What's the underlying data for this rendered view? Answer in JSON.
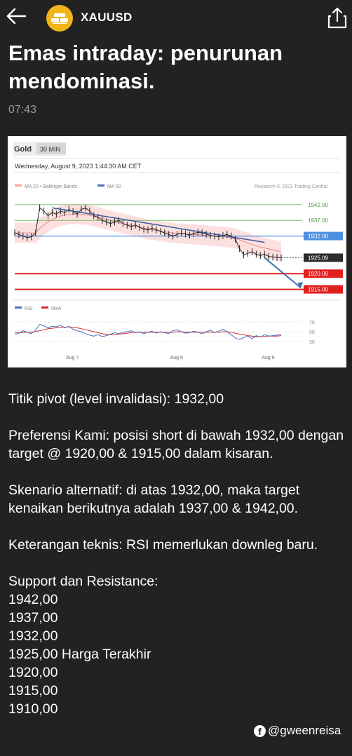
{
  "header": {
    "symbol": "XAUUSD",
    "back_icon": "arrow-left-icon",
    "share_icon": "share-icon",
    "logo_icon": "gold-bars-icon",
    "logo_color": "#f0b519"
  },
  "article": {
    "title": "Emas intraday: penurunan mendominasi.",
    "time": "07:43",
    "paragraphs": [
      "Titik pivot (level invalidasi): 1932,00",
      "Preferensi Kami: posisi short di bawah 1932,00 dengan target @ 1920,00 & 1915,00 dalam kisaran.",
      "Skenario alternatif: di atas 1932,00, maka target kenaikan berikutnya adalah 1937,00 & 1942,00.",
      "Keterangan teknis: RSI memerlukan downleg baru."
    ],
    "sr_title": "Support dan Resistance:",
    "sr_levels": [
      "1942,00",
      "1937,00",
      "1932,00",
      "1925,00 Harga Terakhir",
      "1920,00",
      "1915,00",
      "1910,00"
    ]
  },
  "watermark": {
    "icon": "facebook-icon",
    "text": "@gweenreisa"
  },
  "chart_data": {
    "type": "line",
    "instrument": "Gold",
    "timeframe": "30 MIN",
    "datetime": "Wednesday, August 9, 2023 1:44:30 AM CET",
    "legend": [
      "MA 20 • Bollinger Bands",
      "MA 50"
    ],
    "credit": "Research © 2023 Trading Central",
    "x_ticks": [
      "Aug 7",
      "Aug 8",
      "Aug 9"
    ],
    "ylim": [
      1912,
      1946
    ],
    "levels": [
      {
        "label": "1942.00",
        "value": 1942,
        "color": "#7cc46a",
        "style": "tag-green"
      },
      {
        "label": "1937.00",
        "value": 1937,
        "color": "#7cc46a",
        "style": "tag-green"
      },
      {
        "label": "1932.00",
        "value": 1932,
        "color": "#4d8fe0",
        "style": "box-blue"
      },
      {
        "label": "1925.09",
        "value": 1925.09,
        "color": "#2b2b2b",
        "style": "box-dark"
      },
      {
        "label": "1920.00",
        "value": 1920,
        "color": "#e0201e",
        "style": "box-red"
      },
      {
        "label": "1915.00",
        "value": 1915,
        "color": "#e0201e",
        "style": "box-red"
      }
    ],
    "series": [
      {
        "values": [
          1933,
          1932.5,
          1932,
          1931.5,
          1931.8,
          1933,
          1941,
          1940,
          1938.5,
          1939.5,
          1939,
          1940,
          1939.5,
          1940.5,
          1939.8,
          1939,
          1940.5,
          1941,
          1940,
          1938.5,
          1938,
          1937,
          1936.5,
          1936,
          1936.5,
          1937,
          1936,
          1935.5,
          1935,
          1935.5,
          1934.8,
          1934.2,
          1934,
          1934.5,
          1934,
          1933.5,
          1933,
          1932.5,
          1932,
          1932.5,
          1933,
          1932.7,
          1932.3,
          1932.8,
          1933.2,
          1933,
          1932.6,
          1932.2,
          1932,
          1931.8,
          1932.2,
          1932.5,
          1932,
          1931,
          1928,
          1926,
          1926.5,
          1927,
          1926.2,
          1925.8,
          1926.2,
          1925.5,
          1925.3,
          1925.2,
          1925.1
        ]
      },
      {
        "values": [
          1933,
          1933,
          1933,
          1933,
          1933,
          1933,
          1934.5,
          1935.5,
          1936.5,
          1937.3,
          1937.9,
          1938.4,
          1938.7,
          1938.9,
          1939.0,
          1939.0,
          1938.9,
          1938.8,
          1938.6,
          1938.3,
          1938.0,
          1937.7,
          1937.3,
          1937.0,
          1936.6,
          1936.3,
          1936.0,
          1935.7,
          1935.4,
          1935.1,
          1934.8,
          1934.5,
          1934.2,
          1934.0,
          1933.8,
          1933.6,
          1933.4,
          1933.2,
          1933.0,
          1932.9,
          1932.8,
          1932.7,
          1932.6,
          1932.5,
          1932.4,
          1932.3,
          1932.2,
          1932.1,
          1932.0,
          1931.9,
          1931.8,
          1931.7,
          1931.5,
          1931.2,
          1930.8,
          1930.3,
          1929.8,
          1929.3,
          1928.9,
          1928.5,
          1928.2,
          1927.9,
          1927.6,
          1927.3,
          1927.0
        ]
      }
    ],
    "trendline": {
      "from": [
        9,
        1941
      ],
      "to": [
        60,
        1930
      ]
    },
    "projection": {
      "from": [
        60,
        1925.1
      ],
      "to": [
        64,
        1915.5
      ]
    },
    "rsi": {
      "label": "RSI",
      "ma_label": "9MA",
      "ticks": [
        70,
        50,
        30
      ],
      "ylim": [
        20,
        80
      ],
      "values": [
        44,
        47,
        52,
        49,
        46,
        53,
        65,
        62,
        58,
        61,
        60,
        63,
        58,
        61,
        55,
        52,
        50,
        46,
        43,
        41,
        44,
        40,
        42,
        45,
        48,
        46,
        49,
        50,
        52,
        48,
        50,
        46,
        49,
        51,
        47,
        50,
        48,
        46,
        52,
        54,
        50,
        47,
        48,
        51,
        49,
        46,
        50,
        53,
        48,
        51,
        55,
        50,
        44,
        37,
        34,
        38,
        41,
        36,
        42,
        39,
        44,
        41,
        42,
        43,
        44
      ],
      "ma_values": [
        48,
        48,
        48,
        49,
        49,
        50,
        52,
        54,
        56,
        57,
        58,
        59,
        59,
        60,
        59,
        58,
        56,
        54,
        52,
        50,
        48,
        46,
        45,
        44,
        44,
        45,
        46,
        47,
        48,
        49,
        49,
        49,
        49,
        49,
        49,
        49,
        49,
        49,
        49,
        50,
        50,
        49,
        49,
        49,
        49,
        49,
        49,
        49,
        49,
        49,
        50,
        50,
        49,
        47,
        45,
        44,
        42,
        41,
        40,
        40,
        40,
        41,
        41,
        41,
        42
      ]
    }
  }
}
